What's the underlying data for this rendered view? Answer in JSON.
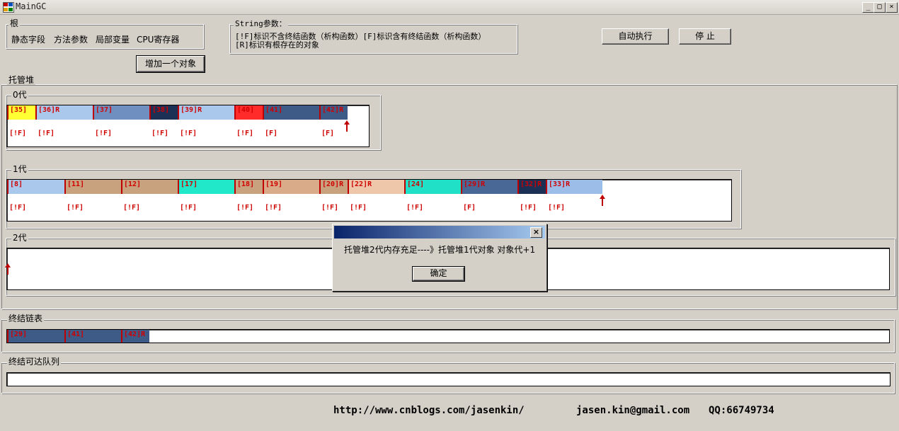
{
  "window": {
    "title": "MainGC",
    "min": "_",
    "max": "□",
    "close": "×"
  },
  "root": {
    "legend": "根",
    "items": [
      "静态字段",
      "方法参数",
      "局部变量",
      "CPU寄存器"
    ]
  },
  "string_params": {
    "legend": "String参数：",
    "line1": "[!F]标识不含终结函数（析构函数）[F]标识含有终结函数（析构函数）",
    "line2": "[R]标识有根存在的对象"
  },
  "buttons": {
    "auto": "自动执行",
    "stop": "停 止",
    "add": "增加一个对象"
  },
  "heap": {
    "legend": "托管堆",
    "gen0": {
      "legend": "0代",
      "cells": [
        {
          "label": "[35]",
          "color": "#ffff33"
        },
        {
          "label": "[36]R",
          "color": "#a9c8ec"
        },
        {
          "label": "[37]",
          "color": "#6f8fc0"
        },
        {
          "label": "[38]",
          "color": "#1c2f55"
        },
        {
          "label": "[39]R",
          "color": "#a9c8ec"
        },
        {
          "label": "[40]",
          "color": "#ff2a2a"
        },
        {
          "label": "[41]",
          "color": "#3e5a86"
        },
        {
          "label": "[42]R",
          "color": "#3e5a86"
        }
      ],
      "flags": [
        "[!F]",
        "[!F]",
        "[!F]",
        "[!F]",
        "[!F]",
        "[!F]",
        "[F]",
        "[F]"
      ]
    },
    "gen1": {
      "legend": "1代",
      "cells": [
        {
          "label": "[8]",
          "color": "#a9c8ec"
        },
        {
          "label": "[11]",
          "color": "#c8a17f"
        },
        {
          "label": "[12]",
          "color": "#c8a17f"
        },
        {
          "label": "[17]",
          "color": "#21e8c8"
        },
        {
          "label": "[18]",
          "color": "#c8a17f"
        },
        {
          "label": "[19]",
          "color": "#d9ab88"
        },
        {
          "label": "[20]R",
          "color": "#c8a17f"
        },
        {
          "label": "[22]R",
          "color": "#eec7ab"
        },
        {
          "label": "[24]",
          "color": "#21e0c8"
        },
        {
          "label": "[29]R",
          "color": "#4a6896"
        },
        {
          "label": "[32]R",
          "color": "#1c2f55"
        },
        {
          "label": "[33]R",
          "color": "#9cbde8"
        }
      ],
      "flags": [
        "[!F]",
        "[!F]",
        "[!F]",
        "[!F]",
        "[!F]",
        "[!F]",
        "[!F]",
        "[!F]",
        "[!F]",
        "[F]",
        "[!F]",
        "[!F]"
      ]
    },
    "gen2": {
      "legend": "2代"
    }
  },
  "finalization_list": {
    "legend": "终结链表",
    "cells": [
      {
        "label": "[29]",
        "color": "#3e5a86"
      },
      {
        "label": "[41]",
        "color": "#3e5a86"
      },
      {
        "label": "[42]R",
        "color": "#3e5a86"
      }
    ]
  },
  "freachable_queue": {
    "legend": "终结可达队列"
  },
  "dialog": {
    "message": "托管堆2代内存充足----》托管堆1代对象  对象代+1",
    "ok": "确定",
    "close": "×"
  },
  "footer": {
    "url": "http://www.cnblogs.com/jasenkin/",
    "email": "jasen.kin@gmail.com",
    "qq": "QQ:66749734"
  }
}
